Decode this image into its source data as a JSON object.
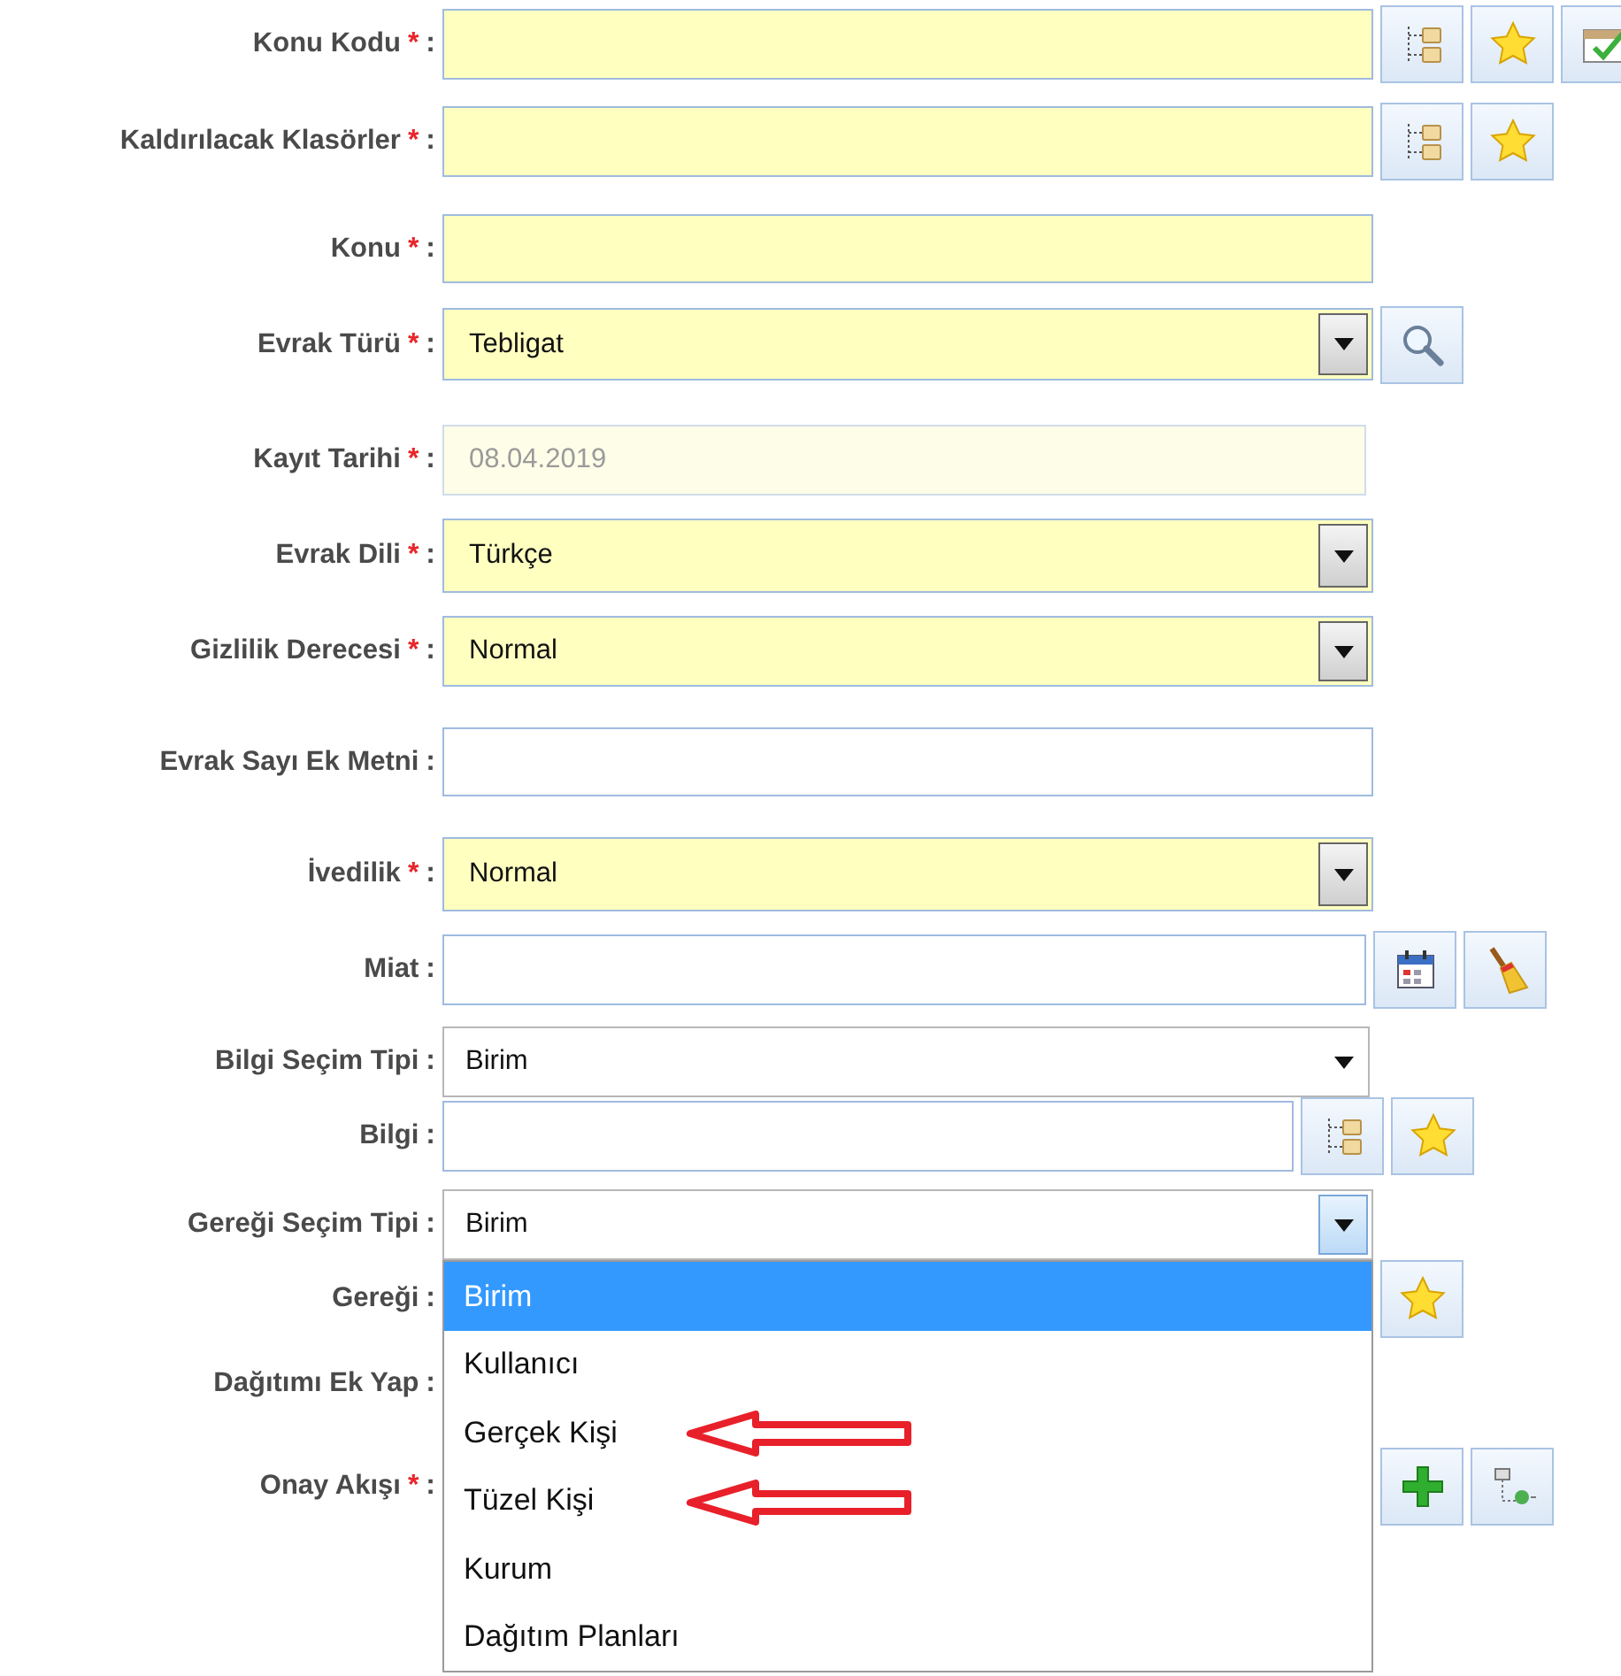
{
  "fields": [
    {
      "label": "Konu Kodu",
      "mark": "*",
      "colon": ":",
      "required": true,
      "kind": "text",
      "buttons": [
        {
          "kind": "tree"
        },
        {
          "kind": "star"
        },
        {
          "kind": "check"
        }
      ]
    },
    {
      "label": "Kaldırılacak Klasörler",
      "mark": "*",
      "colon": ":",
      "required": true,
      "kind": "text",
      "buttons": [
        {
          "kind": "tree"
        },
        {
          "kind": "star"
        }
      ]
    },
    {
      "label": "Konu",
      "mark": "*",
      "colon": ":",
      "required": true,
      "kind": "text"
    },
    {
      "label": "Evrak Türü",
      "mark": "*",
      "colon": ":",
      "required": true,
      "kind": "select",
      "value": "Tebligat",
      "buttons": [
        {
          "kind": "search"
        }
      ]
    },
    {
      "label": "Kayıt Tarihi",
      "mark": "*",
      "colon": ":",
      "required": true,
      "kind": "text",
      "disabled": true,
      "value": "08.04.2019"
    },
    {
      "label": "Evrak Dili",
      "mark": "*",
      "colon": ":",
      "required": true,
      "kind": "select",
      "value": "Türkçe"
    },
    {
      "label": "Gizlilik Derecesi",
      "mark": "*",
      "colon": ":",
      "required": true,
      "kind": "select",
      "value": "Normal"
    },
    {
      "label": "Evrak Sayı Ek Metni",
      "colon": ":",
      "required": false,
      "kind": "text"
    },
    {
      "label": "İvedilik",
      "mark": "*",
      "colon": ":",
      "required": true,
      "kind": "select",
      "value": "Normal"
    },
    {
      "label": "Miat",
      "colon": ":",
      "required": false,
      "kind": "text",
      "buttons": [
        {
          "kind": "calendar"
        },
        {
          "kind": "broom"
        }
      ]
    },
    {
      "label": "Bilgi Seçim Tipi",
      "colon": ":",
      "required": false,
      "kind": "plainselect",
      "value": "Birim"
    },
    {
      "label": "Bilgi",
      "colon": ":",
      "required": false,
      "kind": "text",
      "buttons": [
        {
          "kind": "tree"
        },
        {
          "kind": "star"
        }
      ]
    },
    {
      "label": "Gereği Seçim Tipi",
      "colon": ":",
      "required": false,
      "kind": "plainselect",
      "value": "Birim",
      "open": true,
      "options": [
        {
          "label": "Birim",
          "selected": true,
          "marked": false
        },
        {
          "label": "Kullanıcı",
          "selected": false,
          "marked": false
        },
        {
          "label": "Gerçek Kişi",
          "selected": false,
          "marked": true
        },
        {
          "label": "Tüzel Kişi",
          "selected": false,
          "marked": true
        },
        {
          "label": "Kurum",
          "selected": false,
          "marked": false
        },
        {
          "label": "Dağıtım Planları",
          "selected": false,
          "marked": false
        }
      ]
    },
    {
      "label": "Gereği",
      "colon": ":",
      "kind": "covered",
      "buttons": [
        {
          "kind": "star"
        }
      ]
    },
    {
      "label": "Dağıtımı Ek Yap",
      "colon": ":",
      "kind": "covered"
    },
    {
      "label": "Onay Akışı",
      "mark": "*",
      "colon": ":",
      "kind": "covered",
      "buttons": [
        {
          "kind": "plus"
        },
        {
          "kind": "flow"
        }
      ]
    }
  ]
}
